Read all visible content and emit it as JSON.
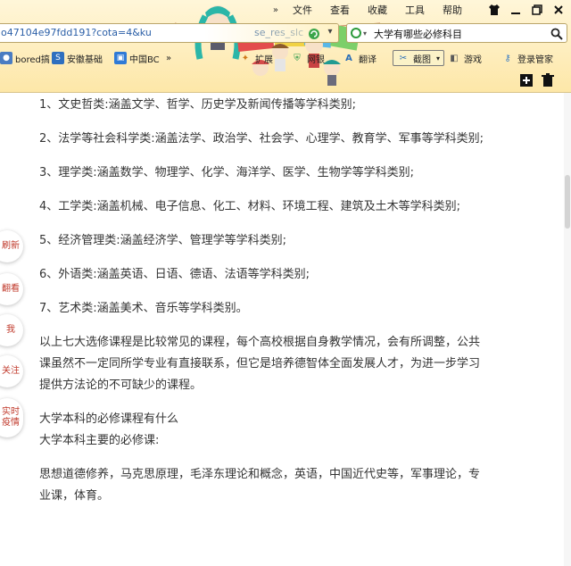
{
  "menubar": {
    "more": "»",
    "items": [
      "文件",
      "查看",
      "收藏",
      "工具",
      "帮助"
    ],
    "window_buttons": [
      "shirt-icon",
      "minimize-icon",
      "restore-icon",
      "close-icon"
    ]
  },
  "address": {
    "url": "o47104e97fdd191?cota=4&ku",
    "url_tail": "se_res_slc"
  },
  "search": {
    "query": "大学有哪些必修科目"
  },
  "favorites": [
    {
      "label": "bored搞",
      "icon": "globe-icon"
    },
    {
      "label": "安徽基础",
      "icon": "site-icon"
    },
    {
      "label": "中国BC",
      "icon": "tv-icon"
    }
  ],
  "toolbar": {
    "more": "»",
    "extension": "扩展",
    "netbank": "网银",
    "translate": "翻译",
    "screenshot": "截图",
    "games": "游戏",
    "login_manager": "登录管家"
  },
  "side_buttons": [
    {
      "label": "刷新"
    },
    {
      "label": "翻看"
    },
    {
      "label": "我"
    },
    {
      "label": "关注"
    },
    {
      "label": "实时疫情"
    }
  ],
  "content": {
    "p1": "1、文史哲类:涵盖文学、哲学、历史学及新闻传播等学科类别;",
    "p2": "2、法学等社会科学类:涵盖法学、政治学、社会学、心理学、教育学、军事等学科类别;",
    "p3": "3、理学类:涵盖数学、物理学、化学、海洋学、医学、生物学等学科类别;",
    "p4": "4、工学类:涵盖机械、电子信息、化工、材料、环境工程、建筑及土木等学科类别;",
    "p5": "5、经济管理类:涵盖经济学、管理学等学科类别;",
    "p6": "6、外语类:涵盖英语、日语、德语、法语等学科类别;",
    "p7": "7、艺术类:涵盖美术、音乐等学科类别。",
    "p8": "以上七大选修课程是比较常见的课程，每个高校根据自身教学情况，会有所调整，公共课虽然不一定同所学专业有直接联系，但它是培养德智体全面发展人才，为进一步学习提供方法论的不可缺少的课程。",
    "p9a": "大学本科的必修课程有什么",
    "p9b": "大学本科主要的必修课:",
    "p10": "思想道德修养，马克思原理，毛泽东理论和概念，英语，中国近代史等，军事理论，专业课，体育。"
  }
}
